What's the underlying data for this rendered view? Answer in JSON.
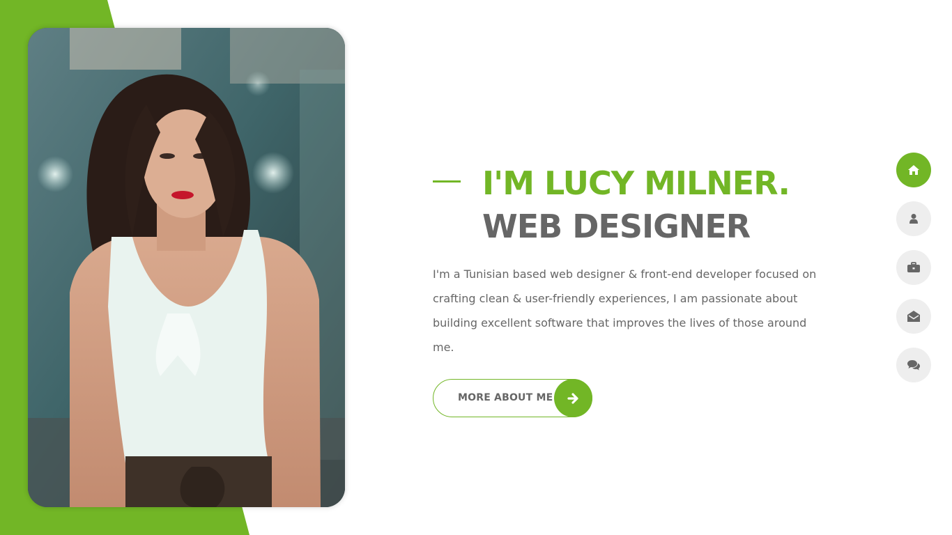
{
  "hero": {
    "photo_alt": "Portrait of Lucy Milner",
    "title_line1": "I'M LUCY MILNER.",
    "title_line2": "WEB DESIGNER",
    "intro": "I'm a Tunisian based web designer & front-end developer focused on crafting clean & user-friendly experiences, I am passionate about building excellent software that improves the lives of those around me.",
    "cta_label": "MORE ABOUT ME",
    "cta_icon": "arrow-right-icon"
  },
  "side_nav": {
    "items": [
      {
        "name": "home",
        "icon": "home-icon",
        "active": true
      },
      {
        "name": "about",
        "icon": "user-icon",
        "active": false
      },
      {
        "name": "portfolio",
        "icon": "briefcase-icon",
        "active": false
      },
      {
        "name": "contact",
        "icon": "envelope-open-icon",
        "active": false
      },
      {
        "name": "blog",
        "icon": "comments-icon",
        "active": false
      }
    ]
  },
  "colors": {
    "accent": "#72b626",
    "heading_dark": "#666666",
    "text": "#666666",
    "nav_bg": "#eeeeee"
  }
}
